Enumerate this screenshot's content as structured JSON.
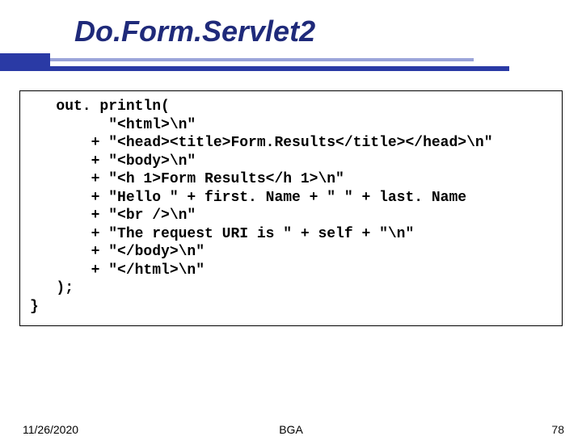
{
  "title": "Do.Form.Servlet2",
  "code": {
    "l1": "   out. println(",
    "l2": "         \"<html>\\n\"",
    "l3": "       + \"<head><title>Form.Results</title></head>\\n\"",
    "l4": "       + \"<body>\\n\"",
    "l5": "       + \"<h 1>Form Results</h 1>\\n\"",
    "l6": "       + \"Hello \" + first. Name + \" \" + last. Name",
    "l7": "       + \"<br />\\n\"",
    "l8": "       + \"The request URI is \" + self + \"\\n\"",
    "l9": "       + \"</body>\\n\"",
    "l10": "       + \"</html>\\n\"",
    "l11": "   );",
    "l12": "}"
  },
  "footer": {
    "date": "11/26/2020",
    "center": "BGA",
    "page": "78"
  }
}
